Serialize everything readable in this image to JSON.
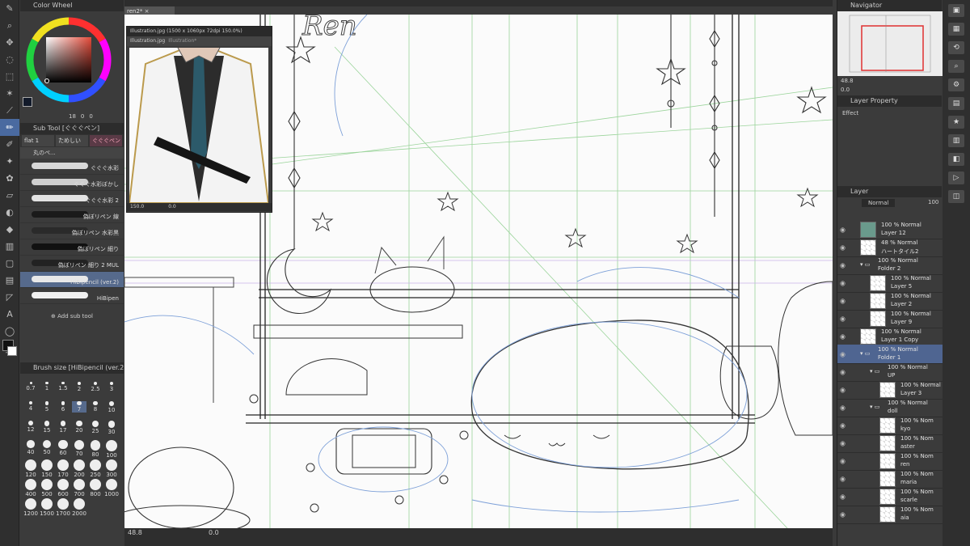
{
  "document_tab": "ren2*",
  "color_wheel": {
    "title": "Color Wheel",
    "value1": "18",
    "value2": "0",
    "value3": "0"
  },
  "sub_tool": {
    "title": "Sub Tool [ぐぐぐペン]",
    "tabs": [
      "flat 1",
      "ためしい",
      "ぐぐぐペン"
    ],
    "group": "丸のペ...",
    "brushes": [
      {
        "name": "ぐぐぐ水彩",
        "color": "#d8d8d8"
      },
      {
        "name": "ぐぐぐ水彩ぼかし",
        "color": "#cfcfcf"
      },
      {
        "name": "ぐぐぐ水彩 2",
        "color": "#e2e2e2"
      },
      {
        "name": "偽ぼリペン 線",
        "color": "#1a1a1a"
      },
      {
        "name": "偽ぼリペン 水彩黒",
        "color": "#2a2a2a"
      },
      {
        "name": "偽ぼリペン 細り",
        "color": "#111111"
      },
      {
        "name": "偽ぼリペン 細り 2 MUL",
        "color": "#222222"
      },
      {
        "name": "HiBipencil (ver.2)",
        "color": "#e8e8e8"
      },
      {
        "name": "HiBipen",
        "color": "#f0f0f0"
      }
    ],
    "add_label": "Add sub tool"
  },
  "brush_size": {
    "title": "Brush size [HiBipencil (ver.2)]",
    "values": [
      "0.7",
      "1",
      "1.5",
      "2",
      "2.5",
      "3",
      "4",
      "5",
      "6",
      "7",
      "8",
      "10",
      "12",
      "15",
      "17",
      "20",
      "25",
      "30",
      "40",
      "50",
      "60",
      "70",
      "80",
      "100",
      "120",
      "150",
      "170",
      "200",
      "250",
      "300",
      "400",
      "500",
      "600",
      "700",
      "800",
      "1000",
      "1200",
      "1500",
      "1700",
      "2000"
    ],
    "selected": "7"
  },
  "reference_window": {
    "tabs": [
      "Illustration.jpg (1500 x 1060px 72dpi 150.0%)"
    ],
    "subtabs": [
      "Illustration.jpg",
      "Illustration*"
    ],
    "zoom": "150.0",
    "angle": "0.0"
  },
  "status": {
    "zoom": "48.8",
    "angle": "0.0"
  },
  "navigator": {
    "title": "Navigator",
    "zoom": "48.8",
    "angle": "0.0"
  },
  "layer_property": {
    "title": "Layer Property",
    "effect": "Effect"
  },
  "layer_panel": {
    "title": "Layer",
    "blend": "Normal",
    "opacity": "100",
    "layers": [
      {
        "mode": "100 % Normal",
        "name": "Layer 12",
        "indent": 0,
        "type": "color",
        "thumb": "#6a9a8c"
      },
      {
        "mode": "48 % Normal",
        "name": "ハートタイル2",
        "indent": 0,
        "type": "layer"
      },
      {
        "mode": "100 % Normal",
        "name": "Folder 2",
        "indent": 0,
        "type": "folder"
      },
      {
        "mode": "100 % Normal",
        "name": "Layer 5",
        "indent": 1,
        "type": "layer"
      },
      {
        "mode": "100 % Normal",
        "name": "Layer 2",
        "indent": 1,
        "type": "layer"
      },
      {
        "mode": "100 % Normal",
        "name": "Layer 9",
        "indent": 1,
        "type": "layer"
      },
      {
        "mode": "100 % Normal",
        "name": "Layer 1 Copy",
        "indent": 0,
        "type": "layer"
      },
      {
        "mode": "100 % Normal",
        "name": "Folder 1",
        "indent": 0,
        "type": "folder",
        "selected": true
      },
      {
        "mode": "100 % Normal",
        "name": "UP",
        "indent": 1,
        "type": "folder"
      },
      {
        "mode": "100 % Normal",
        "name": "Layer 3",
        "indent": 2,
        "type": "layer"
      },
      {
        "mode": "100 % Normal",
        "name": "doll",
        "indent": 1,
        "type": "folder"
      },
      {
        "mode": "100 % Nom",
        "name": "kyo",
        "indent": 2,
        "type": "layer"
      },
      {
        "mode": "100 % Nom",
        "name": "aster",
        "indent": 2,
        "type": "layer"
      },
      {
        "mode": "100 % Nom",
        "name": "ren",
        "indent": 2,
        "type": "layer"
      },
      {
        "mode": "100 % Nom",
        "name": "maria",
        "indent": 2,
        "type": "layer"
      },
      {
        "mode": "100 % Nom",
        "name": "scarle",
        "indent": 2,
        "type": "layer"
      },
      {
        "mode": "100 % Nom",
        "name": "aia",
        "indent": 2,
        "type": "layer"
      }
    ]
  },
  "colors": {
    "accent": "#4f6591",
    "panel": "#3b3b3b",
    "canvas": "#fbfbfb",
    "sketch_blue": "#7da0d8",
    "guide_green": "#8fcf8f"
  }
}
